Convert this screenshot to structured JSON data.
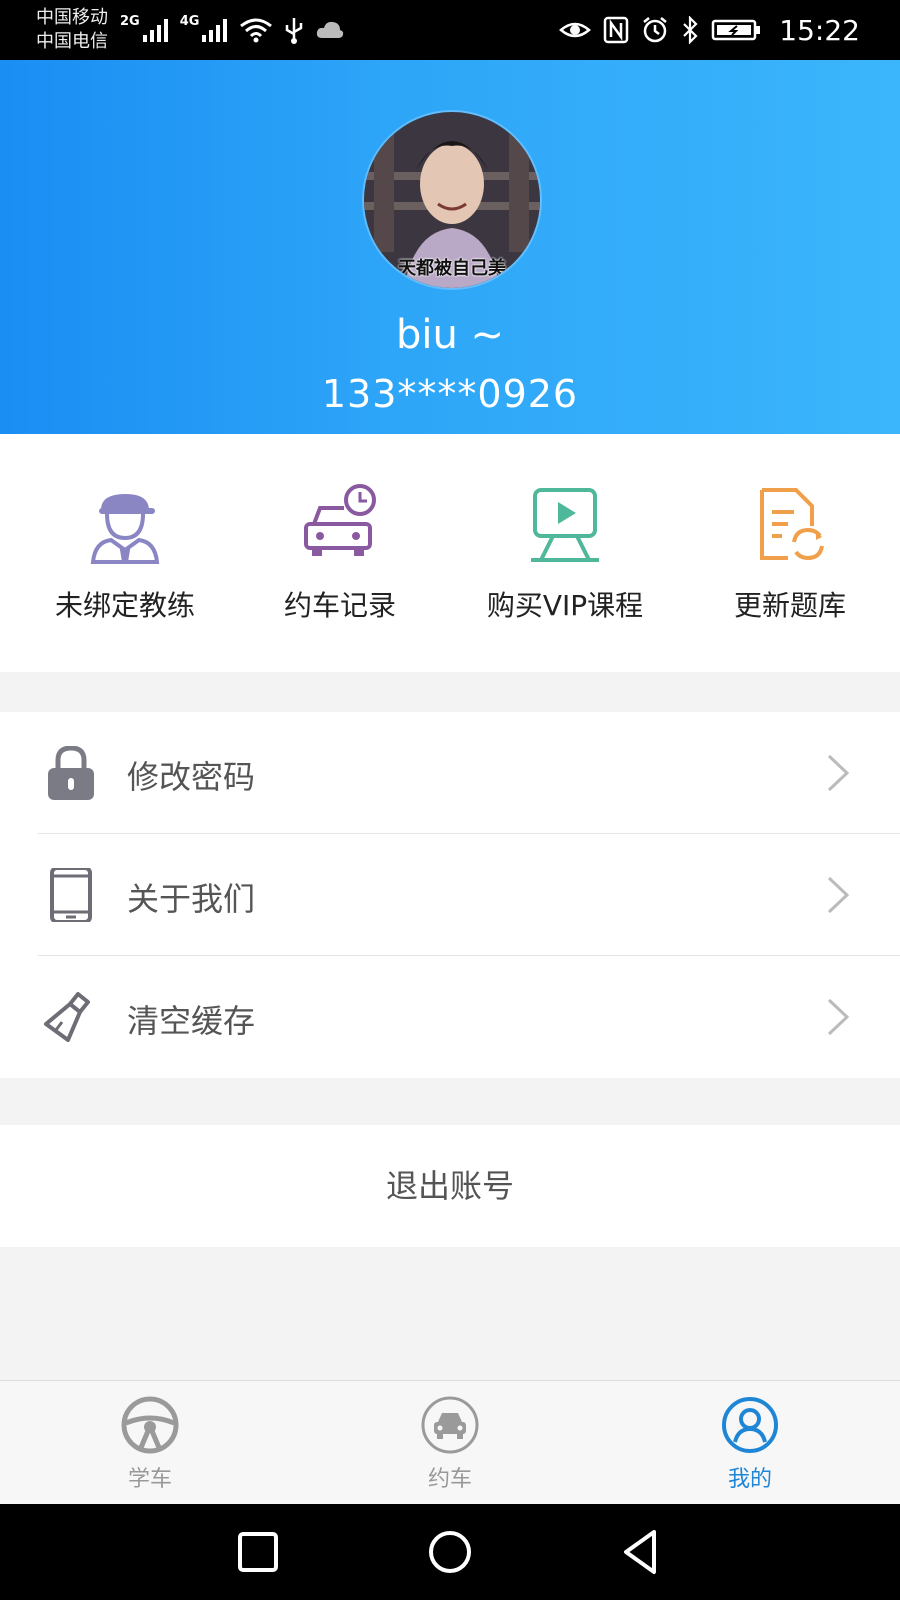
{
  "status_bar": {
    "carrier_1": "中国移动",
    "carrier_2": "中国电信",
    "net_1": "2G",
    "net_2": "4G",
    "time": "15:22"
  },
  "profile": {
    "avatar_caption": "天都被自己美",
    "name": "biu ~",
    "phone": "133****0926"
  },
  "quick_actions": [
    {
      "label": "未绑定教练",
      "icon": "coach-icon",
      "color": "#8a86c4"
    },
    {
      "label": "约车记录",
      "icon": "car-clock-icon",
      "color": "#8a5aa0"
    },
    {
      "label": "购买VIP课程",
      "icon": "video-course-icon",
      "color": "#4fb89a"
    },
    {
      "label": "更新题库",
      "icon": "update-doc-icon",
      "color": "#f0a04a"
    }
  ],
  "menu": [
    {
      "label": "修改密码",
      "icon": "lock-icon"
    },
    {
      "label": "关于我们",
      "icon": "phone-icon"
    },
    {
      "label": "清空缓存",
      "icon": "brush-icon"
    }
  ],
  "logout_label": "退出账号",
  "tabs": [
    {
      "label": "学车",
      "icon": "steering-wheel-icon",
      "active": false
    },
    {
      "label": "约车",
      "icon": "car-icon",
      "active": false
    },
    {
      "label": "我的",
      "icon": "user-icon",
      "active": true
    }
  ],
  "colors": {
    "header_gradient_start": "#1a8ef3",
    "header_gradient_end": "#3bb5fb",
    "tab_active": "#1f86d6",
    "tab_inactive": "#999999"
  }
}
